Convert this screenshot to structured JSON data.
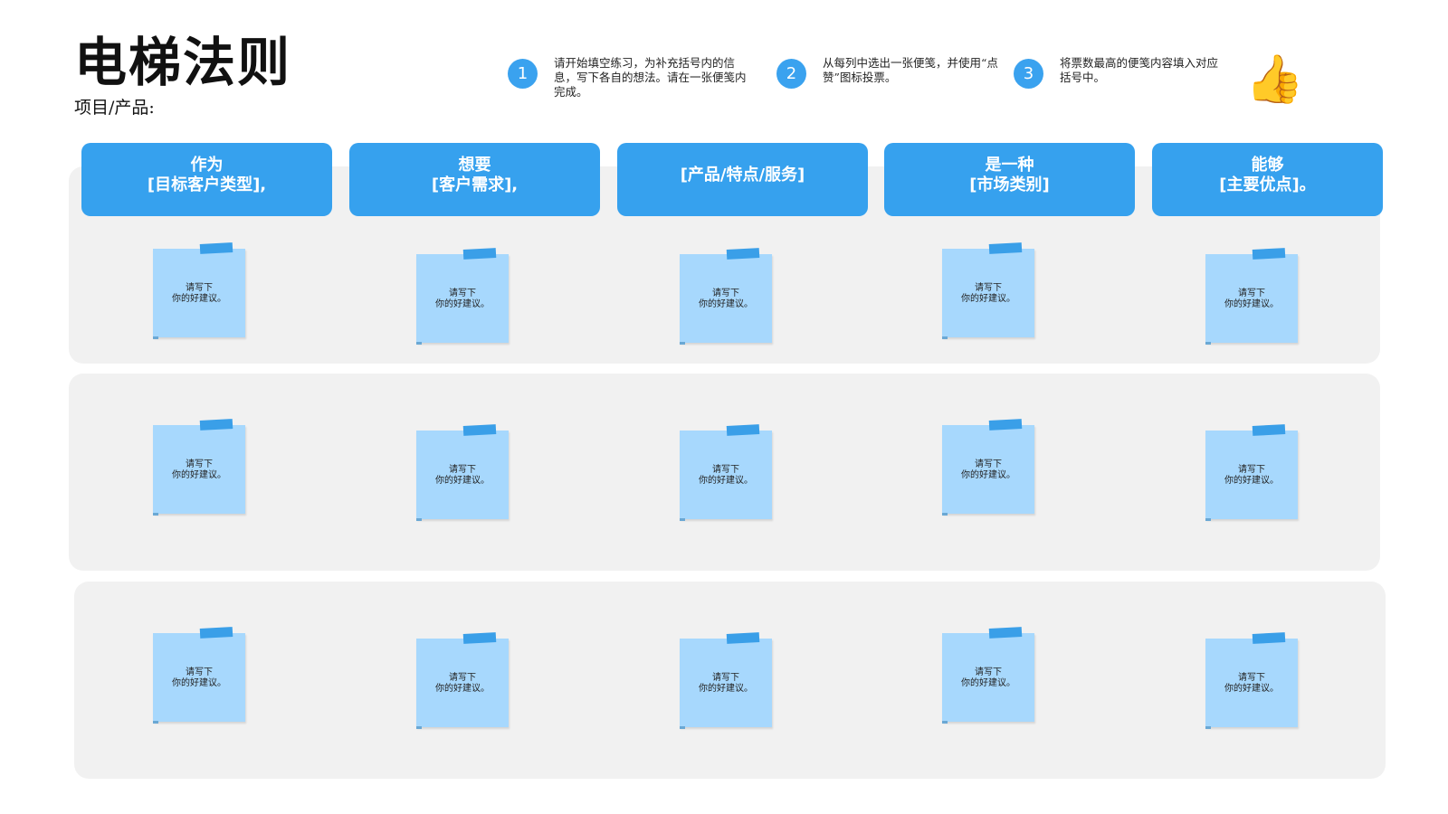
{
  "title": "电梯法则",
  "subtitle": "项目/产品:",
  "instructions": [
    {
      "num": "1",
      "text": "请开始填空练习，为补充括号内的信息，写下各自的想法。请在一张便笺内完成。"
    },
    {
      "num": "2",
      "text": "从每列中选出一张便笺，并使用“点赞”图标投票。"
    },
    {
      "num": "3",
      "text": "将票数最高的便笺内容填入对应括号中。"
    }
  ],
  "vote_icon": {
    "name": "thumbs-up-icon",
    "glyph": "👍",
    "color": "#f4b400"
  },
  "columns": [
    {
      "line1": "作为",
      "line2": "[目标客户类型],"
    },
    {
      "line1": "想要",
      "line2": "[客户需求],"
    },
    {
      "line1": "[产品/特点/服务]",
      "line2": ""
    },
    {
      "line1": "是一种",
      "line2": "[市场类别]"
    },
    {
      "line1": "能够",
      "line2": "[主要优点]。"
    }
  ],
  "note_text": {
    "line1": "请写下",
    "line2": "你的好建议。"
  },
  "colors": {
    "accent": "#36a1ee",
    "note": "#a7d8fd",
    "tape": "#3a9fe8",
    "panel": "#f1f1f1"
  }
}
